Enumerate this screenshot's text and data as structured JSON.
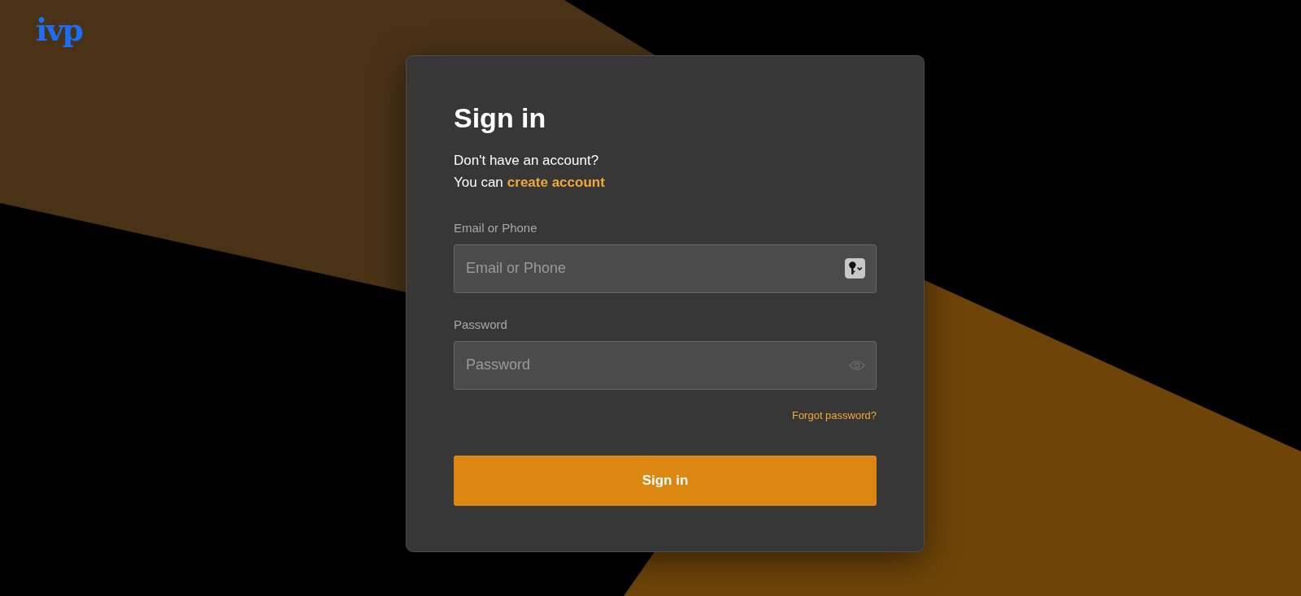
{
  "logo": "ivp",
  "card": {
    "title": "Sign in",
    "prompt": "Don't have an account?",
    "link_lead": "You can",
    "link": "create account",
    "fields": [
      {
        "label": "Email or Phone",
        "placeholder": "Email or Phone",
        "kind": "key"
      },
      {
        "label": "Password",
        "placeholder": "Password",
        "kind": "eye"
      }
    ],
    "forgot": "Forgot password?",
    "button": "Sign in"
  }
}
